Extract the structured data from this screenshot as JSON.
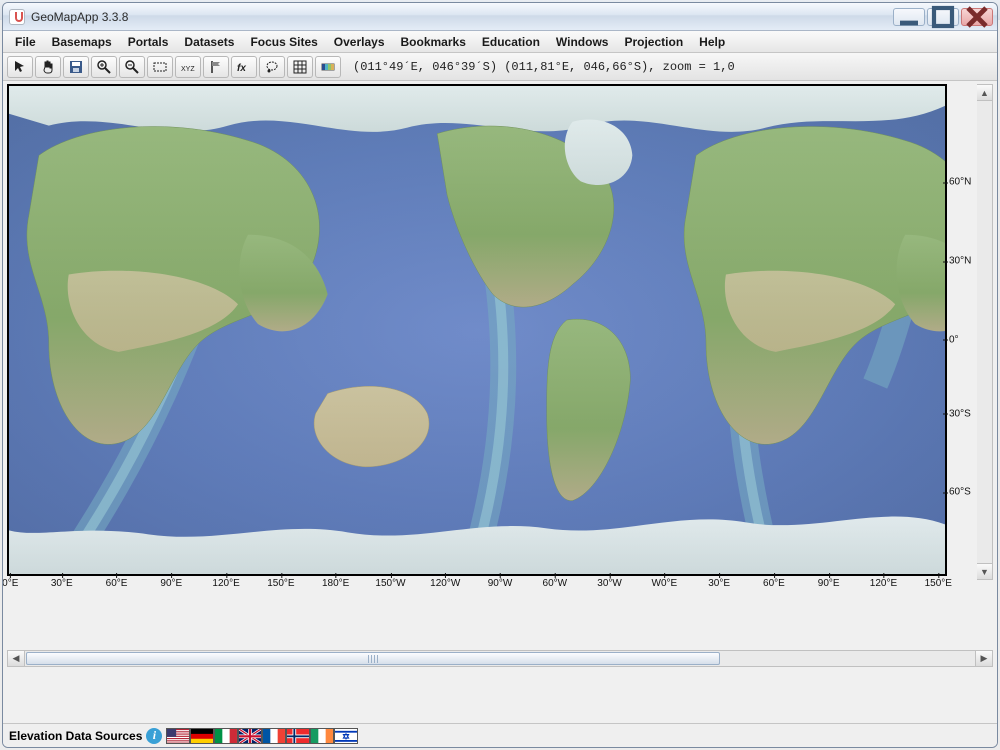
{
  "window": {
    "title": "GeoMapApp 3.3.8"
  },
  "menu": [
    "File",
    "Basemaps",
    "Portals",
    "Datasets",
    "Focus Sites",
    "Overlays",
    "Bookmarks",
    "Education",
    "Windows",
    "Projection",
    "Help"
  ],
  "toolbar": {
    "buttons": [
      {
        "name": "pointer-icon"
      },
      {
        "name": "pan-hand-icon"
      },
      {
        "name": "save-icon"
      },
      {
        "name": "zoom-in-icon"
      },
      {
        "name": "zoom-out-icon"
      },
      {
        "name": "zoom-region-icon"
      },
      {
        "name": "xyz-profile-icon"
      },
      {
        "name": "flag-marker-icon"
      },
      {
        "name": "fx-function-icon"
      },
      {
        "name": "lasso-select-icon"
      },
      {
        "name": "grid-toggle-icon"
      },
      {
        "name": "color-palette-icon"
      }
    ],
    "coord": "(011°49´E, 046°39´S) (011,81°E, 046,66°S), zoom = 1,0"
  },
  "map": {
    "latTicks": [
      {
        "label": "60°N",
        "frac": 0.2
      },
      {
        "label": "30°N",
        "frac": 0.36
      },
      {
        "label": "0°",
        "frac": 0.52
      },
      {
        "label": "30°S",
        "frac": 0.67
      },
      {
        "label": "60°S",
        "frac": 0.83
      }
    ],
    "lonTicks": [
      {
        "label": "0°E",
        "frac": 0.005
      },
      {
        "label": "30°E",
        "frac": 0.083
      },
      {
        "label": "60°E",
        "frac": 0.166
      },
      {
        "label": "90°E",
        "frac": 0.249
      },
      {
        "label": "120°E",
        "frac": 0.332
      },
      {
        "label": "150°E",
        "frac": 0.415
      },
      {
        "label": "180°E",
        "frac": 0.498
      },
      {
        "label": "150°W",
        "frac": 0.581
      },
      {
        "label": "120°W",
        "frac": 0.664
      },
      {
        "label": "90°W",
        "frac": 0.747
      },
      {
        "label": "60°W",
        "frac": 0.83
      },
      {
        "label": "30°W",
        "frac": 0.913
      },
      {
        "label": "W0°E",
        "frac": 0.996
      },
      {
        "label": "30°E",
        "frac": 1.079
      },
      {
        "label": "60°E",
        "frac": 1.162
      },
      {
        "label": "90°E",
        "frac": 1.245
      },
      {
        "label": "120°E",
        "frac": 1.328
      },
      {
        "label": "150°E",
        "frac": 1.411
      }
    ]
  },
  "footer": {
    "label": "Elevation Data Sources",
    "flags": [
      "us",
      "de",
      "it",
      "gb",
      "fr",
      "no",
      "ie",
      "il"
    ]
  }
}
